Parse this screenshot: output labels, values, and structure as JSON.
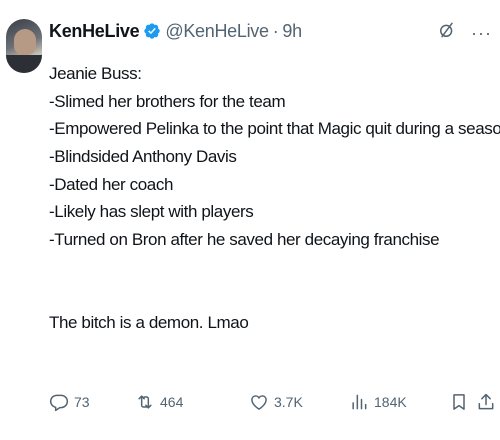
{
  "author": {
    "display_name": "KenHeLive",
    "handle": "@KenHeLive",
    "separator": "·",
    "time": "9h",
    "verified": true,
    "verified_color": "#1d9bf0"
  },
  "tweet": {
    "lines": [
      "Jeanie Buss:",
      "-Slimed her brothers for the team",
      "-Empowered Pelinka to the point that Magic quit during a season",
      "-Blindsided Anthony Davis",
      "-Dated her coach",
      "-Likely has slept with players",
      "-Turned on Bron after he saved her decaying franchise"
    ],
    "closing": "The bitch is a demon. Lmao"
  },
  "actions": {
    "replies": "73",
    "reposts": "464",
    "likes": "3.7K",
    "views": "184K"
  },
  "icons": {
    "top": [
      "grok-icon",
      "more-icon"
    ],
    "actions": [
      "reply-icon",
      "repost-icon",
      "like-icon",
      "views-icon",
      "bookmark-icon",
      "share-icon"
    ]
  },
  "colors": {
    "text": "#0f1419",
    "secondary": "#536471"
  }
}
